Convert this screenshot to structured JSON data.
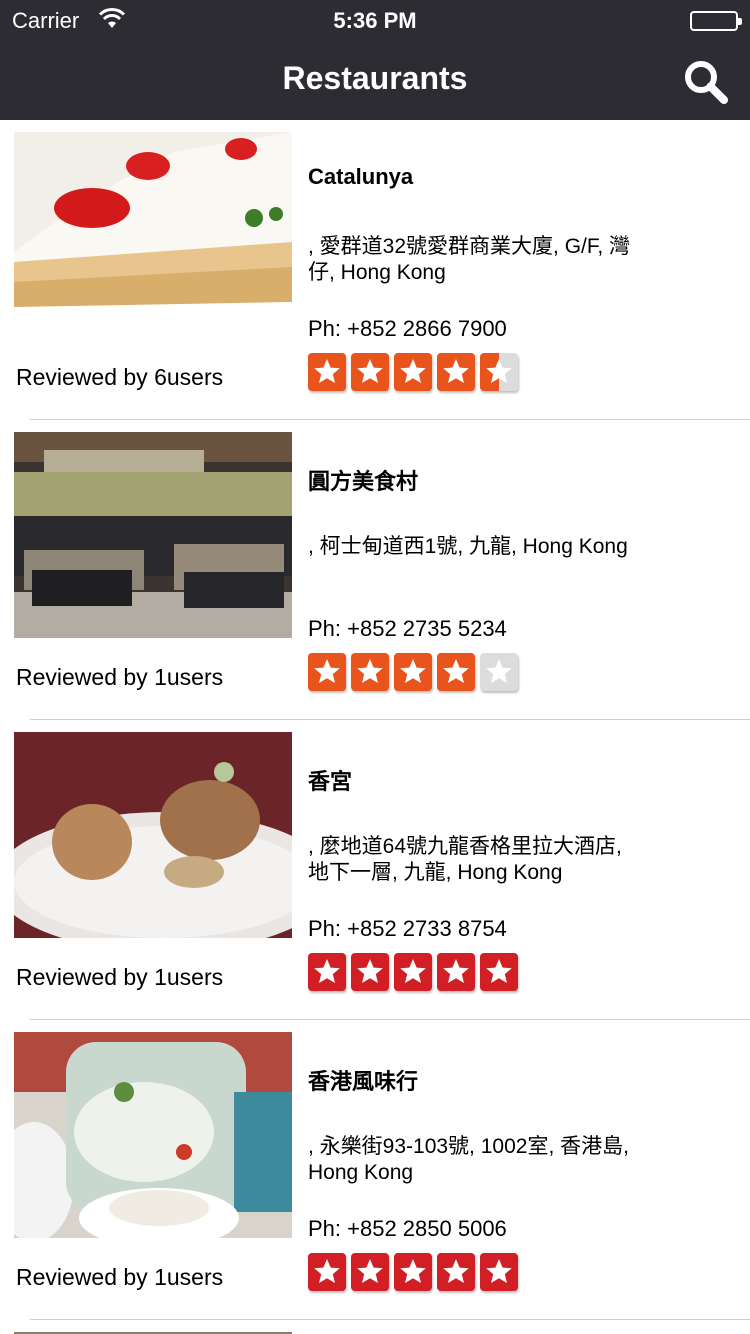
{
  "status": {
    "carrier": "Carrier",
    "time": "5:36 PM"
  },
  "nav": {
    "title": "Restaurants"
  },
  "colors": {
    "star_orange": "#e8541b",
    "star_red": "#d21f26",
    "star_empty": "#dcdcdc",
    "header": "#2d2c33"
  },
  "icons": {
    "search": "search-icon",
    "wifi": "wifi-icon",
    "battery": "battery-icon"
  },
  "restaurants": [
    {
      "name": "Catalunya",
      "address": ", 愛群道32號愛群商業大廈, G/F, 灣仔, Hong Kong",
      "phone": "Ph: +852 2866 7900",
      "reviewed": "Reviewed by 6users",
      "rating": 4.5,
      "star_color": "orange"
    },
    {
      "name": "圓方美食村",
      "address": ", 柯士甸道西1號, 九龍, Hong Kong",
      "phone": "Ph: +852 2735 5234",
      "reviewed": "Reviewed by 1users",
      "rating": 4,
      "star_color": "orange"
    },
    {
      "name": "香宮",
      "address": ", 麼地道64號九龍香格里拉大酒店, 地下一層, 九龍, Hong Kong",
      "phone": "Ph: +852 2733 8754",
      "reviewed": "Reviewed by 1users",
      "rating": 5,
      "star_color": "red"
    },
    {
      "name": "香港風味行",
      "address": ", 永樂街93-103號, 1002室, 香港島, Hong Kong",
      "phone": "Ph: +852 2850 5006",
      "reviewed": "Reviewed by 1users",
      "rating": 5,
      "star_color": "red"
    }
  ]
}
